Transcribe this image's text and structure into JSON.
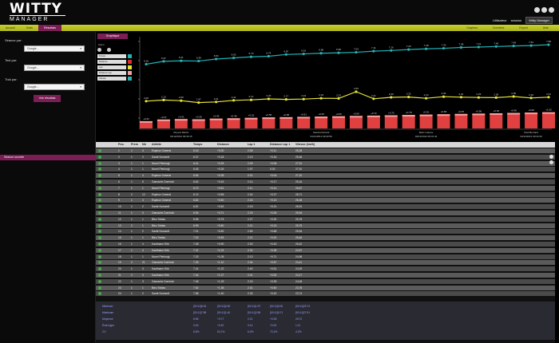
{
  "app": {
    "logo_top": "WITTY",
    "logo_bottom": "MANAGER"
  },
  "topright": {
    "user": "Utilisateur",
    "session": "session",
    "dropdown": "Witty Manager"
  },
  "nav": {
    "tabs": [
      "Accueil",
      "Tests",
      "Résultats"
    ],
    "active": 2,
    "right": [
      "Graphes",
      "Données",
      "Export",
      "Aide"
    ]
  },
  "sidebar": {
    "groups": [
      {
        "label": "Séance par:",
        "value": "Google..."
      },
      {
        "label": "Test par:",
        "value": "Google..."
      },
      {
        "label": "Trial par:",
        "value": "Google..."
      }
    ],
    "apply": "Voir résultats",
    "section": "Séance ouverte"
  },
  "chart": {
    "tab": "Graphique",
    "legend_header": "Zoom",
    "legend_items": [
      "Temps",
      "Distance",
      "Lap",
      "Distance Lap",
      "Vitesse"
    ],
    "legend_colors": [
      "#23b2b5",
      "#e02b2b",
      "#e5e23a",
      "#f2a4a4",
      "#23b2b5"
    ],
    "annotations": [
      "Dupont Martin",
      "Sandra Durand",
      "Marc Lefevre",
      "Paul Bernard"
    ],
    "annotation_dates": [
      "04/12/2012 09:30:15",
      "04/12/2012 09:30:59",
      "04/12/2012 09:31:44",
      "04/12/2012 09:32:20"
    ]
  },
  "chart_data": {
    "type": "line",
    "series": [
      {
        "values": [
          6.16,
          6.37,
          6.41,
          6.39,
          6.54,
          6.62,
          6.7,
          6.74,
          6.87,
          6.91,
          6.96,
          6.99,
          7.03,
          7.11,
          7.16,
          7.23,
          7.28,
          7.32,
          7.38,
          7.41,
          7.45,
          7.49,
          7.52,
          7.58
        ]
      },
      {
        "values": [
          2.06,
          2.13,
          2.09,
          1.97,
          2.01,
          2.11,
          2.14,
          2.2,
          2.17,
          2.19,
          2.24,
          2.23,
          2.65,
          2.21,
          2.3,
          2.32,
          2.24,
          2.34,
          2.31,
          2.29,
          2.28,
          2.35,
          2.26,
          2.31
        ]
      },
      {
        "values": [
          0.22,
          0.37,
          0.41,
          0.39,
          0.45,
          0.48,
          0.52,
          0.56,
          0.58,
          0.61,
          0.63,
          0.66,
          0.69,
          0.72,
          0.75,
          0.78,
          0.81,
          0.84,
          0.87,
          0.9,
          0.93,
          0.96,
          0.99,
          1.02
        ]
      }
    ]
  },
  "table": {
    "headers": [
      "Pos.",
      "Prem",
      "Nb",
      "Athlète",
      "Temps",
      "Distance",
      "Lap 1",
      "Distance Lap 1",
      "Vitesse (km/h)"
    ],
    "rows": [
      [
        "1",
        "1",
        "4",
        "Espinoz Ceserai",
        "6.16",
        "+0.00",
        "2.06",
        "+0.11",
        "25,28"
      ],
      [
        "2",
        "1",
        "2",
        "Santé Nonnedt",
        "6.37",
        "+0.18",
        "2.13",
        "+0.16",
        "25,46"
      ],
      [
        "3",
        "1",
        "1",
        "Nonel Pierlongi",
        "6.41",
        "+0.25",
        "2.09",
        "+0.06",
        "27,91"
      ],
      [
        "4",
        "1",
        "1",
        "Nonel Pierlongi",
        "6.45",
        "+0.26",
        "1.97",
        "0.00",
        "27,91"
      ],
      [
        "5",
        "1",
        "4",
        "Espinoz Ceserai",
        "6.54",
        "+0.35",
        "2.01",
        "+0.04",
        "27,10"
      ],
      [
        "6",
        "1",
        "5",
        "Gamache Dominici",
        "6.62",
        "+0.43",
        "2.14",
        "+0.17",
        "25,16"
      ],
      [
        "7",
        "1",
        "1",
        "Nonel Pierlongi",
        "6.70",
        "+0.51",
        "2.11",
        "+0.14",
        "26,67"
      ],
      [
        "8",
        "2",
        "12",
        "Espinoz Ceserai",
        "6.74",
        "+0.55",
        "2.24",
        "+0.27",
        "26,71"
      ],
      [
        "9",
        "1",
        "4",
        "Espinoz Ceserai",
        "6.82",
        "+0.60",
        "2.18",
        "+0.13",
        "26,48"
      ],
      [
        "10",
        "1",
        "2",
        "Santé Nonnedt",
        "6.87",
        "+0.62",
        "2.15",
        "+0.21",
        "26,91"
      ],
      [
        "11",
        "1",
        "3",
        "Gamache Dominici",
        "6.94",
        "+0.71",
        "2.23",
        "+0.26",
        "25,94"
      ],
      [
        "12",
        "1",
        "1",
        "Bleu Tobias",
        "6.96",
        "+0.75",
        "2.27",
        "+0.30",
        "25,78"
      ],
      [
        "13",
        "2",
        "1",
        "Bleu Tobias",
        "6.99",
        "+0.80",
        "2.21",
        "+0.24",
        "25,75"
      ],
      [
        "14",
        "1",
        "2",
        "Santé Nonnedt",
        "7.01",
        "+0.82",
        "2.65",
        "+0.68",
        "25,54"
      ],
      [
        "15",
        "1",
        "1",
        "Bleu Tobias",
        "7.02",
        "+0.83",
        "2.21",
        "+0.20",
        "25,64"
      ],
      [
        "16",
        "1",
        "4",
        "Kaufmann Erik",
        "7.08",
        "+0.90",
        "2.30",
        "+0.43",
        "25,42"
      ],
      [
        "17",
        "1",
        "4",
        "Kaufmann Erik",
        "7.21",
        "+1.02",
        "2.32",
        "+0.35",
        "24,57"
      ],
      [
        "18",
        "1",
        "1",
        "Nonel Pierlongi",
        "7.23",
        "+1.05",
        "2.13",
        "+0.71",
        "24,96"
      ],
      [
        "19",
        "2",
        "21",
        "Gamache Dominici",
        "7.25",
        "+1.10",
        "2.34",
        "+0.57",
        "24,41"
      ],
      [
        "20",
        "1",
        "3",
        "Kaufmann Erik",
        "7.41",
        "+1.22",
        "2.40",
        "+0.51",
        "24,29"
      ],
      [
        "21",
        "2",
        "3",
        "Kaufmann Erik",
        "7.44",
        "+1.27",
        "2.41",
        "+0.52",
        "24,17"
      ],
      [
        "22",
        "1",
        "3",
        "Gamache Dominici",
        "7.48",
        "+1.29",
        "2.15",
        "+0.39",
        "24,06"
      ],
      [
        "23",
        "1",
        "1",
        "Bleu Tobias",
        "7.52",
        "+1.35",
        "2.31",
        "+0.50",
        "23,78"
      ],
      [
        "24",
        "1",
        "2",
        "Santé Nonnedt",
        "7.58",
        "+1.40",
        "2.33",
        "+0.42",
        "23,74"
      ]
    ],
    "summary": [
      [
        "Minimum",
        "[00:11]6:15",
        "[00:11]0:00",
        "[00:11]1:97",
        "[00:11]0:00",
        "[00:11]23:74"
      ],
      [
        "Maximum",
        "[00:11]7:58",
        "[00:11]1:40",
        "[00:11]2:65",
        "[00:11]0:71",
        "[00:11]27:91"
      ],
      [
        "Moyenne",
        "6:96",
        "+0:77",
        "2:21",
        "+0:28",
        "25:72"
      ],
      [
        "Écart-type",
        "0:40",
        "+0:40",
        "0:14",
        "+0:20",
        "1:11"
      ],
      [
        "CV",
        "5,8%",
        "52,1%",
        "6,3%",
        "72,4%",
        "4,3%"
      ]
    ]
  }
}
